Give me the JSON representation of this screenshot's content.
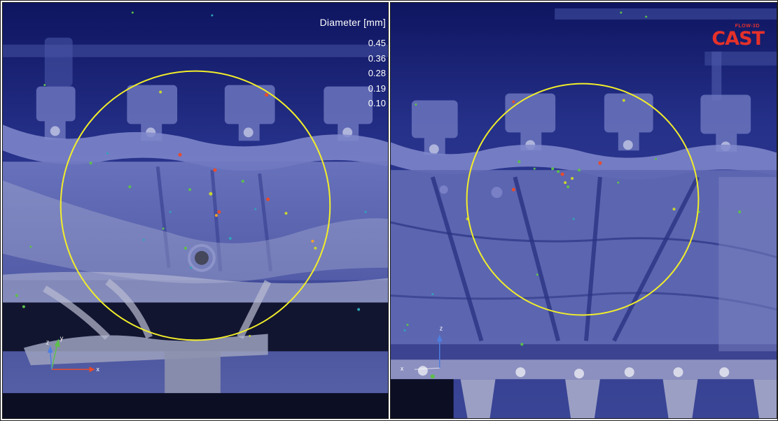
{
  "legend": {
    "title": "Diameter [mm]",
    "ticks": [
      "0.45",
      "0.36",
      "0.28",
      "0.19",
      "0.10"
    ],
    "colors": [
      "#e84b2c",
      "#f0a22c",
      "#c9d42e",
      "#5cc04a",
      "#2ea5b8",
      "#1b4bd6"
    ]
  },
  "logo": {
    "brand": "CAST",
    "tagline": "FLOW-3D"
  },
  "axes": {
    "x": "x",
    "y": "y",
    "z": "z"
  },
  "highlight_color": "#f2ee2a",
  "background_color": "#1f2a78"
}
